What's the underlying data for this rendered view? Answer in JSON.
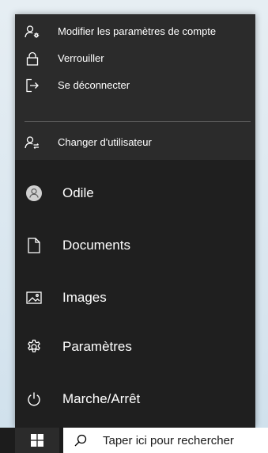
{
  "account_menu": {
    "items": [
      {
        "label": "Modifier les paramètres de compte",
        "icon": "account-settings-icon"
      },
      {
        "label": "Verrouiller",
        "icon": "lock-icon"
      },
      {
        "label": "Se déconnecter",
        "icon": "sign-out-icon"
      }
    ],
    "switch_user": {
      "label": "Changer d'utilisateur",
      "icon": "switch-user-icon"
    }
  },
  "start_menu": {
    "user": {
      "label": "Odile",
      "icon": "avatar-icon"
    },
    "items": [
      {
        "label": "Documents",
        "icon": "document-icon"
      },
      {
        "label": "Images",
        "icon": "picture-icon"
      },
      {
        "label": "Paramètres",
        "icon": "gear-icon"
      },
      {
        "label": "Marche/Arrêt",
        "icon": "power-icon"
      }
    ]
  },
  "taskbar": {
    "start_icon": "windows-logo-icon",
    "search": {
      "placeholder": "Taper ici pour rechercher",
      "icon": "search-icon"
    }
  },
  "colors": {
    "panel_bg": "#1f1f1f",
    "flyout_bg": "#2b2b2b",
    "text": "#ffffff",
    "taskbar_bg": "#1c1c1c",
    "search_bg": "#ffffff"
  }
}
